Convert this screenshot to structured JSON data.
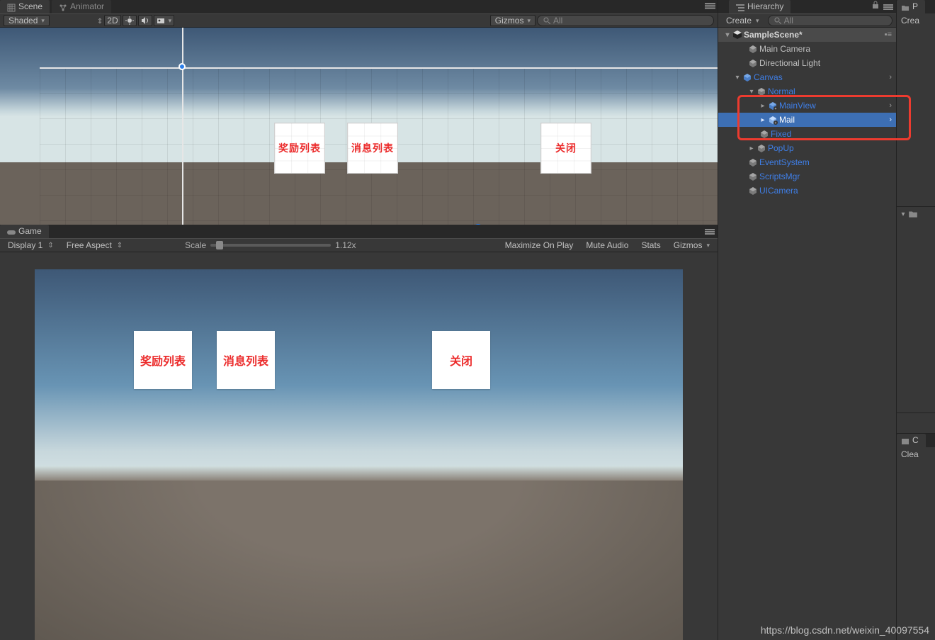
{
  "scene": {
    "tabs": {
      "scene": "Scene",
      "animator": "Animator"
    },
    "toolbar": {
      "shaded": "Shaded",
      "mode2d": "2D",
      "gizmos": "Gizmos"
    },
    "cards": {
      "reward": "奖励列表",
      "message": "消息列表",
      "close": "关闭"
    }
  },
  "game": {
    "tab": "Game",
    "display": "Display 1",
    "aspect": "Free Aspect",
    "scale_label": "Scale",
    "scale_value": "1.12x",
    "maximize": "Maximize On Play",
    "mute": "Mute Audio",
    "stats": "Stats",
    "gizmos": "Gizmos",
    "cards": {
      "reward": "奖励列表",
      "message": "消息列表",
      "close": "关闭"
    }
  },
  "hierarchy": {
    "title": "Hierarchy",
    "create": "Create",
    "search_placeholder": "All",
    "scene": "SampleScene*",
    "items": {
      "main_camera": "Main Camera",
      "directional_light": "Directional Light",
      "canvas": "Canvas",
      "normal": "Normal",
      "mainview": "MainView",
      "mail": "Mail",
      "fixed": "Fixed",
      "popup": "PopUp",
      "eventsystem": "EventSystem",
      "scriptsmgr": "ScriptsMgr",
      "uicamera": "UICamera"
    }
  },
  "right": {
    "tab1": "P",
    "crea": "Crea",
    "tab2": "C",
    "clear": "Clea"
  },
  "watermark": "https://blog.csdn.net/weixin_40097554"
}
